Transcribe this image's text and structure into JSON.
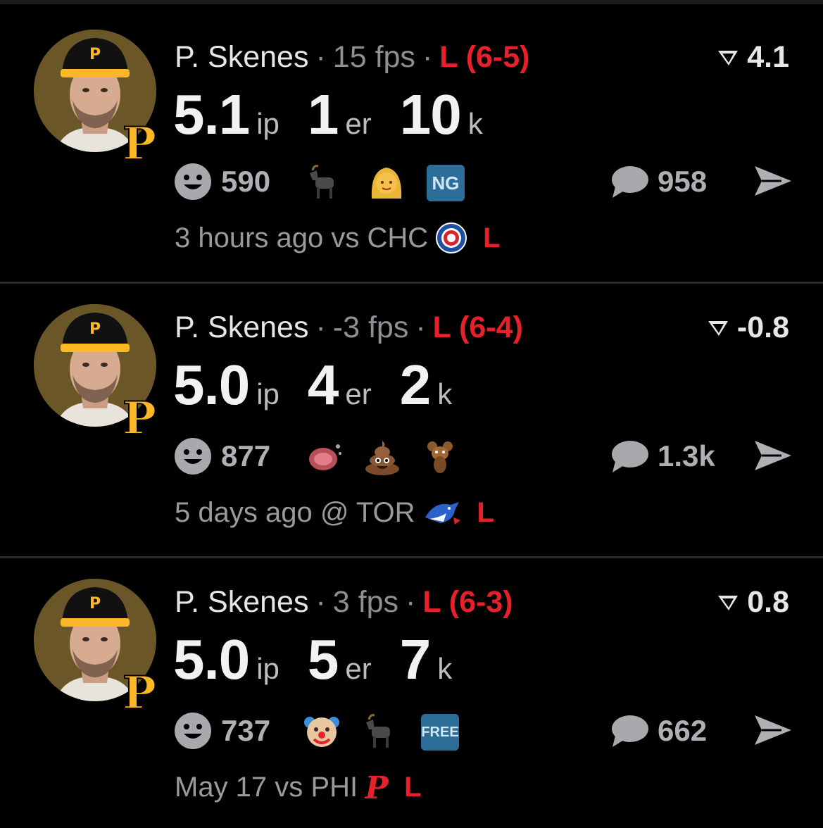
{
  "colors": {
    "background": "#000000",
    "loss_red": "#e8202a",
    "muted": "#8e8e93",
    "pirates_gold": "#fdb827"
  },
  "posts": [
    {
      "player": "P. Skenes",
      "fps": "15 fps",
      "result": "L (6-5)",
      "score": "4.1",
      "stats": [
        {
          "value": "5.1",
          "unit": "ip"
        },
        {
          "value": "1",
          "unit": "er"
        },
        {
          "value": "10",
          "unit": "k"
        }
      ],
      "reaction_count": "590",
      "reaction_icons": [
        "goat-emoji-icon",
        "blonde-woman-emoji-icon",
        "ng-badge-icon"
      ],
      "badge_text": "NG",
      "comment_count": "958",
      "meta": "3 hours ago vs CHC",
      "opponent_logo": "cubs-logo-icon",
      "meta_result": "L"
    },
    {
      "player": "P. Skenes",
      "fps": "-3 fps",
      "result": "L (6-4)",
      "score": "-0.8",
      "stats": [
        {
          "value": "5.0",
          "unit": "ip"
        },
        {
          "value": "4",
          "unit": "er"
        },
        {
          "value": "2",
          "unit": "k"
        }
      ],
      "reaction_count": "877",
      "reaction_icons": [
        "ham-emoji-icon",
        "poop-emoji-icon",
        "rat-emoji-icon"
      ],
      "comment_count": "1.3k",
      "meta": "5 days ago @ TOR",
      "opponent_logo": "blue-jays-logo-icon",
      "meta_result": "L"
    },
    {
      "player": "P. Skenes",
      "fps": "3 fps",
      "result": "L (6-3)",
      "score": "0.8",
      "stats": [
        {
          "value": "5.0",
          "unit": "ip"
        },
        {
          "value": "5",
          "unit": "er"
        },
        {
          "value": "7",
          "unit": "k"
        }
      ],
      "reaction_count": "737",
      "reaction_icons": [
        "clown-emoji-icon",
        "goat-emoji-icon",
        "free-badge-icon"
      ],
      "badge_text": "FREE",
      "comment_count": "662",
      "meta": "May 17 vs PHI",
      "opponent_logo": "phillies-logo-icon",
      "meta_result": "L"
    }
  ]
}
